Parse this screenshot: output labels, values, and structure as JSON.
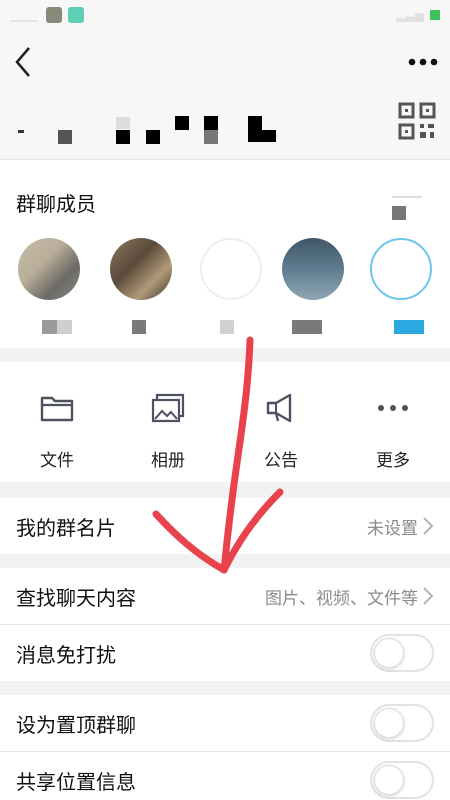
{
  "header": {
    "back_icon": "chevron-left-icon",
    "more_icon": "more-dots-icon",
    "qr_icon": "qr-code-icon"
  },
  "members": {
    "title": "群聊成员",
    "avatars": [
      {
        "name_color": "#9a9a9a"
      },
      {
        "name_color": "#8a8a8a"
      },
      {
        "name_color": "#d0d0d0"
      },
      {
        "name_color": "#7a7a7a"
      },
      {
        "name_color": "#29a9e0"
      }
    ]
  },
  "actions": [
    {
      "label": "文件",
      "icon": "folder-icon"
    },
    {
      "label": "相册",
      "icon": "photo-album-icon"
    },
    {
      "label": "公告",
      "icon": "megaphone-icon"
    },
    {
      "label": "更多",
      "icon": "more-dots-icon"
    }
  ],
  "settings": {
    "my_card": {
      "title": "我的群名片",
      "value": "未设置"
    },
    "search_chat": {
      "title": "查找聊天内容",
      "value": "图片、视频、文件等"
    },
    "mute": {
      "title": "消息免打扰"
    },
    "pin": {
      "title": "设为置顶群聊"
    },
    "share_location": {
      "title": "共享位置信息"
    }
  },
  "colors": {
    "accent_blue": "#29a9e0",
    "annotation_red": "#e8424d",
    "icon_gray": "#4d5160"
  }
}
